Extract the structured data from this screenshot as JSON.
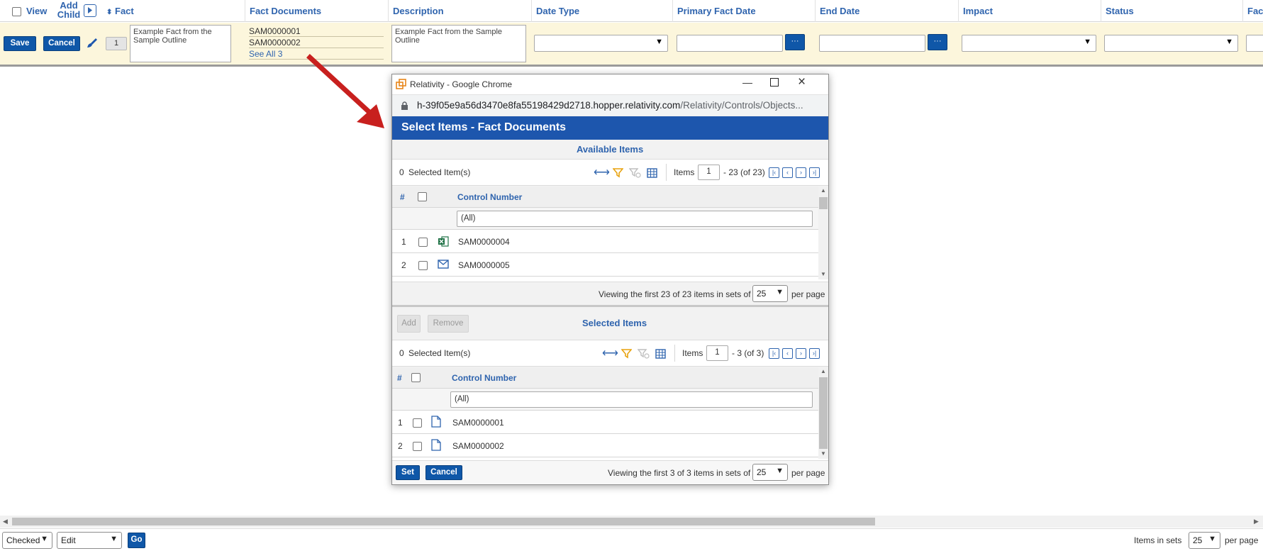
{
  "header": {
    "view_label": "View",
    "add_child_line1": "Add",
    "add_child_line2": "Child",
    "fact_label": "Fact",
    "columns": [
      "Fact Documents",
      "Description",
      "Date Type",
      "Primary Fact Date",
      "End Date",
      "Impact",
      "Status",
      "Fact"
    ]
  },
  "edit_row": {
    "save_label": "Save",
    "cancel_label": "Cancel",
    "row_number": "1",
    "fact_text": "Example Fact from the Sample Outline",
    "documents": [
      "SAM0000001",
      "SAM0000002"
    ],
    "see_all_label": "See All 3",
    "description_text": "Example Fact from the Sample Outline",
    "ellipsis_label": "···"
  },
  "popup": {
    "window_title": "Relativity - Google Chrome",
    "url_host": "h-39f05e9a56d3470e8fa55198429d2718.hopper.relativity.com",
    "url_path": "/Relativity/Controls/Objects...",
    "heading": "Select Items - Fact Documents",
    "available": {
      "title": "Available Items",
      "selected_count": "0",
      "selected_label": "Selected Item(s)",
      "items_label": "Items",
      "page_value": "1",
      "range_text": "- 23 (of 23)",
      "col_hash": "#",
      "col_control": "Control Number",
      "filter_value": "(All)",
      "rows": [
        {
          "num": "1",
          "control": "SAM0000004",
          "icon": "excel-icon"
        },
        {
          "num": "2",
          "control": "SAM0000005",
          "icon": "email-icon"
        }
      ],
      "viewing_text": "Viewing the first 23 of 23 items in sets of",
      "per_page_value": "25",
      "per_page_label": "per page"
    },
    "selected": {
      "add_label": "Add",
      "remove_label": "Remove",
      "title": "Selected Items",
      "selected_count": "0",
      "selected_label": "Selected Item(s)",
      "items_label": "Items",
      "page_value": "1",
      "range_text": "- 3 (of 3)",
      "col_hash": "#",
      "col_control": "Control Number",
      "filter_value": "(All)",
      "rows": [
        {
          "num": "1",
          "control": "SAM0000001",
          "icon": "document-icon"
        },
        {
          "num": "2",
          "control": "SAM0000002",
          "icon": "document-icon"
        }
      ],
      "set_label": "Set",
      "cancel_label": "Cancel",
      "viewing_text": "Viewing the first 3 of 3 items in sets of",
      "per_page_value": "25",
      "per_page_label": "per page"
    }
  },
  "bottom": {
    "mass_select_value": "Checked",
    "mass_action_value": "Edit",
    "go_label": "Go",
    "items_in_sets_label": "Items in sets",
    "per_page_value": "25",
    "per_page_label": "per page"
  },
  "colors": {
    "accent_blue": "#0f57a8",
    "link_blue": "#2f64ae",
    "edit_row_bg": "#fcf6dc",
    "arrow_red": "#c8201e"
  }
}
